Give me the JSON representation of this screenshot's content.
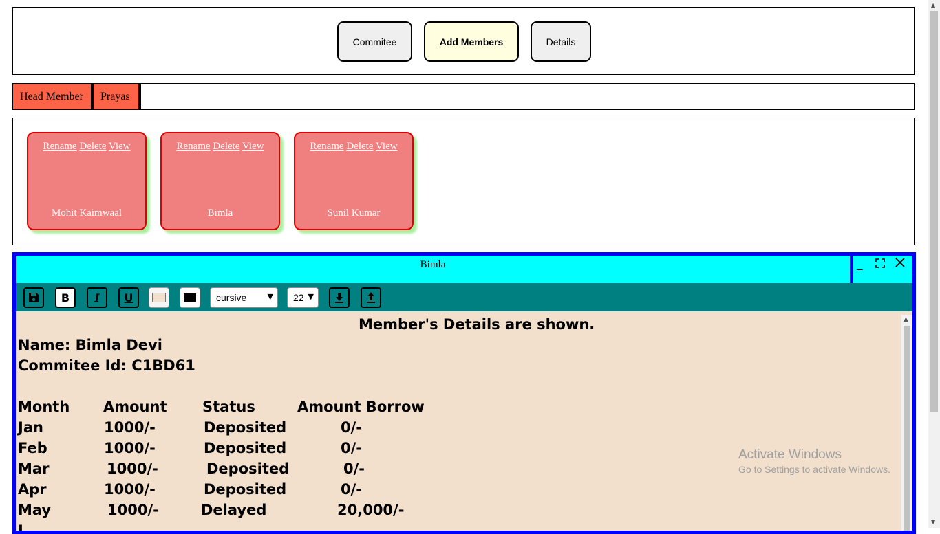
{
  "nav": {
    "buttons": [
      "Commitee",
      "Add Members",
      "Details"
    ],
    "active": "Add Members"
  },
  "tabs": [
    "Head Member",
    "Prayas"
  ],
  "members": [
    {
      "actions": [
        "Rename",
        "Delete",
        "View"
      ],
      "name": "Mohit Kaimwaal"
    },
    {
      "actions": [
        "Rename",
        "Delete",
        "View"
      ],
      "name": "Bimla"
    },
    {
      "actions": [
        "Rename",
        "Delete",
        "View"
      ],
      "name": "Sunil Kumar"
    }
  ],
  "editor": {
    "title": "Bimla",
    "controls": {
      "minimize": "_",
      "maximize": "⛶",
      "close": "✕"
    },
    "toolbar": {
      "font_family": "cursive",
      "font_size": "22",
      "bold": "B",
      "italic": "I",
      "underline": "U"
    },
    "content": {
      "heading": "Member's Details are shown.",
      "name_line": "Name: Bimla Devi",
      "id_line": "Commitee Id: C1BD61",
      "table": {
        "headers": [
          "Month",
          "Amount",
          "Status",
          "Amount Borrow"
        ],
        "rows": [
          [
            "Jan",
            "1000/-",
            "Deposited",
            "0/-"
          ],
          [
            "Feb",
            "1000/-",
            "Deposited",
            "0/-"
          ],
          [
            "Mar",
            "1000/-",
            "Deposited",
            "0/-"
          ],
          [
            "Apr",
            "1000/-",
            "Deposited",
            "0/-"
          ],
          [
            "May",
            "1000/-",
            "Delayed",
            "20,000/-"
          ],
          [
            "J",
            "",
            "",
            ""
          ]
        ]
      }
    }
  },
  "watermark": {
    "line1": "Activate Windows",
    "line2": "Go to Settings to activate Windows."
  },
  "colors": {
    "tab": "#ff6347",
    "card": "#f08080",
    "card_border": "#e00000",
    "titlebar": "#00ffff",
    "window_border": "#0000ff",
    "toolbar": "#008080",
    "editor_bg": "#f2e0cd",
    "active_nav": "#ffffe0"
  }
}
